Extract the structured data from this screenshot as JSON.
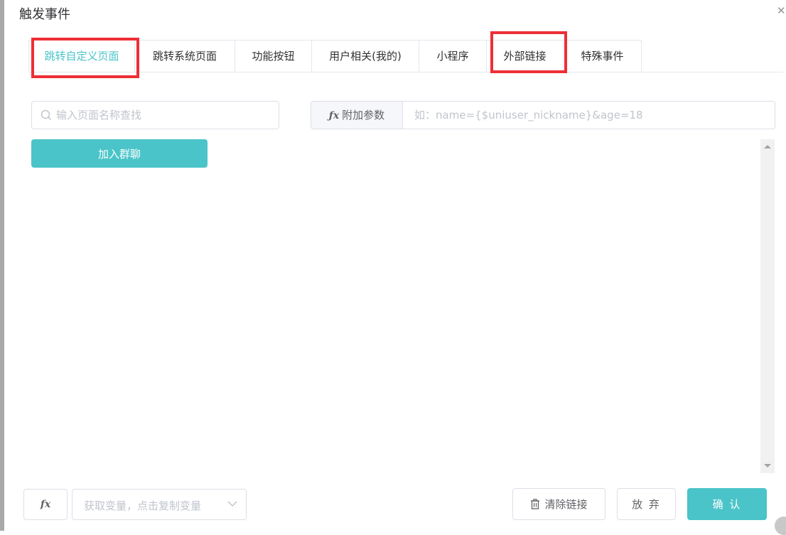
{
  "dialog": {
    "title": "触发事件"
  },
  "tabs": [
    {
      "label": "跳转自定义页面",
      "active": true
    },
    {
      "label": "跳转系统页面",
      "active": false
    },
    {
      "label": "功能按钮",
      "active": false
    },
    {
      "label": "用户相关(我的)",
      "active": false
    },
    {
      "label": "小程序",
      "active": false
    },
    {
      "label": "外部链接",
      "active": false
    },
    {
      "label": "特殊事件",
      "active": false
    }
  ],
  "search": {
    "placeholder": "输入页面名称查找",
    "value": ""
  },
  "params": {
    "prepend_label": "附加参数",
    "placeholder": "如：name={$uniuser_nickname}&age=18",
    "value": ""
  },
  "list": {
    "items": [
      {
        "label": "加入群聊"
      }
    ]
  },
  "footer": {
    "fx_label": "fx",
    "variable_placeholder": "获取变量，点击复制变量",
    "clear_label": "清除链接",
    "discard_label": "放 弃",
    "confirm_label": "确 认"
  },
  "icons": [
    "close-icon",
    "search-icon",
    "fx-icon",
    "chevron-down-icon",
    "trash-icon"
  ],
  "colors": {
    "accent": "#4ac4c8",
    "highlight": "#ee2e36",
    "border": "#dcdfe6",
    "text": "#303133",
    "placeholder": "#c0c4cc"
  }
}
